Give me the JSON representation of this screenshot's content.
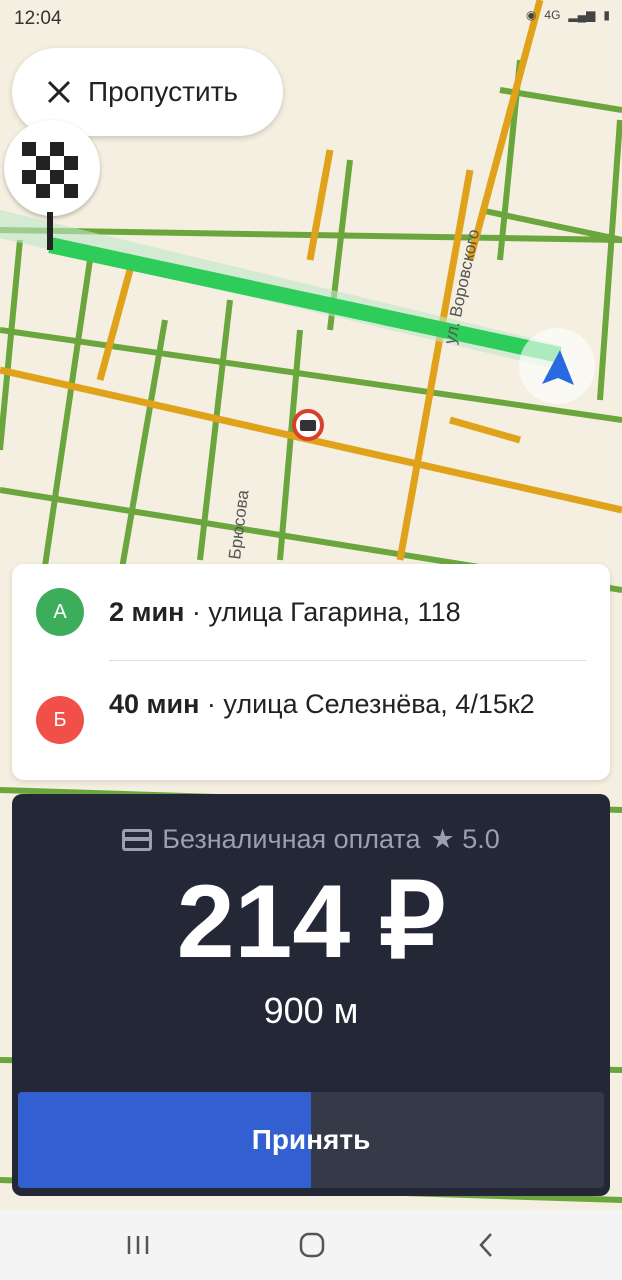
{
  "status_bar": {
    "time": "12:04",
    "network": "4G"
  },
  "skip_button": {
    "label": "Пропустить"
  },
  "map": {
    "street_labels": [
      "ул. Воровского",
      "Брюсова"
    ]
  },
  "route": {
    "pickup": {
      "marker": "А",
      "eta": "2 мин",
      "separator": " · ",
      "address": "улица Гагарина, 118"
    },
    "dropoff": {
      "marker": "Б",
      "eta": "40 мин",
      "separator": " · ",
      "address": "улица Селезнёва, 4/15к2"
    }
  },
  "order": {
    "payment": "Безналичная оплата",
    "rating": "★ 5.0",
    "price": "214 ₽",
    "distance": "900 м",
    "accept_label": "Принять",
    "accept_progress": 0.5
  },
  "colors": {
    "route": "#2ecc5a",
    "traffic_green": "#5aa23a",
    "traffic_orange": "#e0a21a",
    "accept_blue": "#3260d0",
    "panel_dark": "#242836"
  },
  "icons": [
    "close-icon",
    "finish-flag-icon",
    "navigation-arrow-icon",
    "camera-icon",
    "credit-card-icon",
    "recent-apps-icon",
    "home-icon",
    "back-icon"
  ]
}
